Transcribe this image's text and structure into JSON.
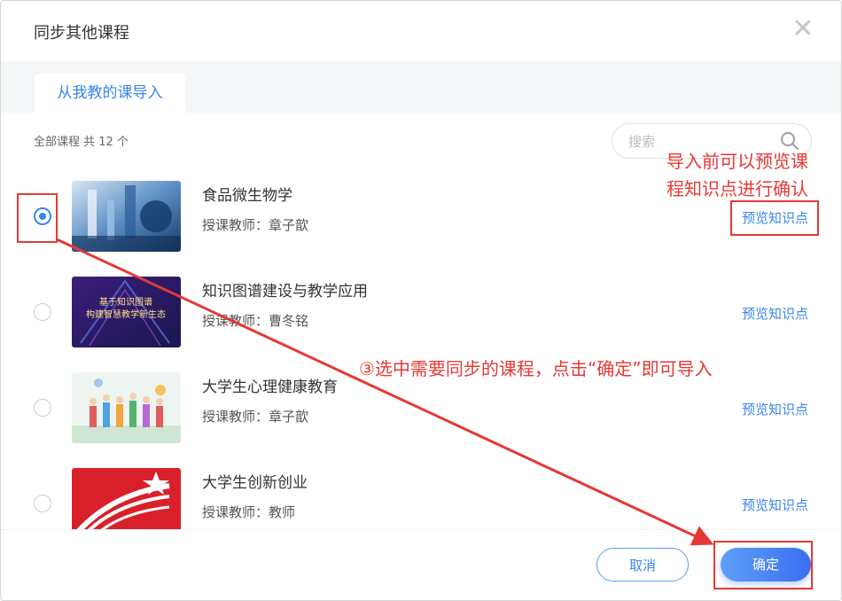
{
  "dialog": {
    "title": "同步其他课程",
    "close_icon": "close-icon",
    "tab_label": "从我教的课导入",
    "count_text": "全部课程 共 12 个",
    "search_placeholder": "搜索"
  },
  "courses": [
    {
      "name": "食品微生物学",
      "teacher": "授课教师：章子歆",
      "preview": "预览知识点",
      "selected": true
    },
    {
      "name": "知识图谱建设与教学应用",
      "teacher": "授课教师：曹冬铭",
      "preview": "预览知识点",
      "selected": false,
      "thumb_text_1": "基于知识图谱",
      "thumb_text_2": "构建智慧教学新生态"
    },
    {
      "name": "大学生心理健康教育",
      "teacher": "授课教师：章子歆",
      "preview": "预览知识点",
      "selected": false
    },
    {
      "name": "大学生创新创业",
      "teacher": "授课教师：教师",
      "preview": "预览知识点",
      "selected": false
    }
  ],
  "footer": {
    "cancel_label": "取消",
    "ok_label": "确定"
  },
  "annotations": {
    "note_preview_line1": "导入前可以预览课",
    "note_preview_line2": "程知识点进行确认",
    "note_select": "③选中需要同步的课程，点击“确定”即可导入",
    "color": "#e53935"
  },
  "colors": {
    "accent": "#3a86e8"
  }
}
